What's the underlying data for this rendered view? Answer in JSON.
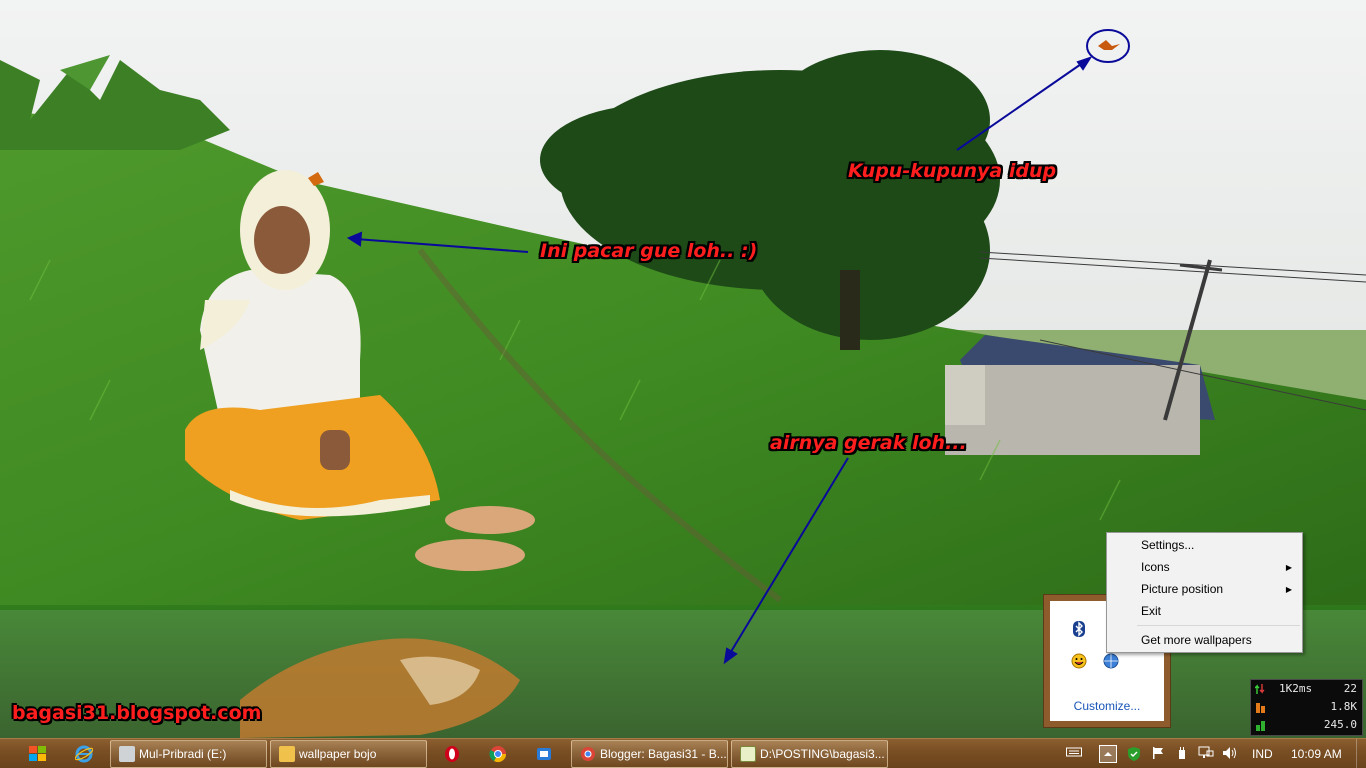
{
  "desktop": {
    "annotations": {
      "butterfly": "Kupu-kupunya idup",
      "girlfriend": "Ini pacar gue loh.. :)",
      "water": "airnya gerak loh..."
    },
    "watermark": "bagasi31.blogspot.com"
  },
  "tray_popup": {
    "icons": [
      "bluetooth-icon",
      "flag-icon",
      "messenger-smiley-icon",
      "globe-update-icon"
    ],
    "customize_label": "Customize..."
  },
  "context_menu": {
    "items": [
      {
        "label": "Settings...",
        "submenu": false
      },
      {
        "label": "Icons",
        "submenu": true
      },
      {
        "label": "Picture position",
        "submenu": true
      },
      {
        "label": "Exit",
        "submenu": false
      },
      {
        "label": "Get more wallpapers",
        "submenu": false
      }
    ]
  },
  "perf_widget": {
    "network_value": "1K2ms",
    "network_count": "22",
    "cpu_value": "1.8K",
    "memory_value": "245.0"
  },
  "taskbar": {
    "windows": [
      {
        "label": "Mul-Pribradi (E:)",
        "icon": "drive-icon"
      },
      {
        "label": "wallpaper bojo",
        "icon": "folder-icon"
      },
      {
        "label": "Blogger: Bagasi31 - B...",
        "icon": "chrome-icon"
      },
      {
        "label": "D:\\POSTING\\bagasi3...",
        "icon": "notepad-icon"
      }
    ],
    "pinned": [
      "start-icon",
      "internet-explorer-icon",
      "opera-icon",
      "chrome-icon",
      "network-app-icon"
    ],
    "language": "IND",
    "clock": "10:09 AM"
  },
  "colors": {
    "annotation_text": "#ff1e1e",
    "taskbar": "#7a4f24",
    "tray_frame": "#8e5c2c",
    "arrow": "#0a0a9a"
  }
}
